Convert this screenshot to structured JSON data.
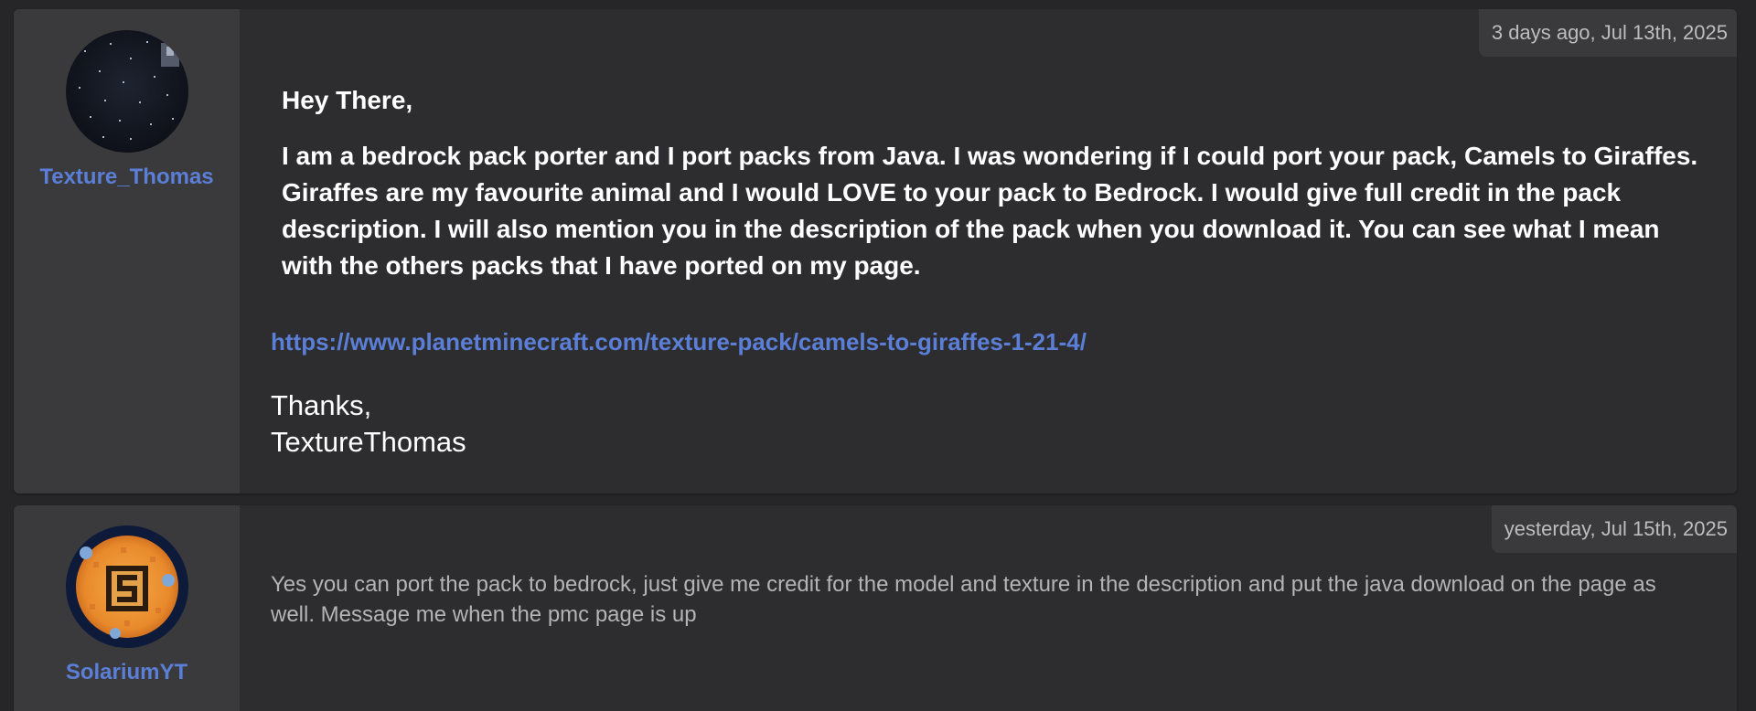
{
  "messages": [
    {
      "author": "Texture_Thomas",
      "timestamp": "3 days ago, Jul 13th, 2025",
      "greeting": "Hey There,",
      "paragraph": "I am a bedrock pack porter and I port packs from Java. I was wondering if I could port your pack, Camels to Giraffes. Giraffes are my favourite animal and I would LOVE to your pack to Bedrock. I would give full credit in the pack description. I will also mention you in the description of the pack when you download it. You can see what I mean with the others packs that I have ported on my page.",
      "link": "https://www.planetminecraft.com/texture-pack/camels-to-giraffes-1-21-4/",
      "signoff_line1": "Thanks,",
      "signoff_line2": "TextureThomas",
      "avatar_icon": "starry-night-avatar"
    },
    {
      "author": "SolariumYT",
      "timestamp": "yesterday, Jul 15th, 2025",
      "text": "Yes you can port the pack to bedrock, just give me credit for the model and texture in the description and put the java download on the page as well. Message me when the pmc page is up",
      "avatar_icon": "sun-logo-avatar"
    }
  ],
  "colors": {
    "page_bg": "#262628",
    "card_bg": "#2d2d30",
    "sidebar_bg": "#3a3a3d",
    "link": "#5b7fd6",
    "body_text": "#ffffff",
    "muted_text": "#b4b4b4"
  }
}
